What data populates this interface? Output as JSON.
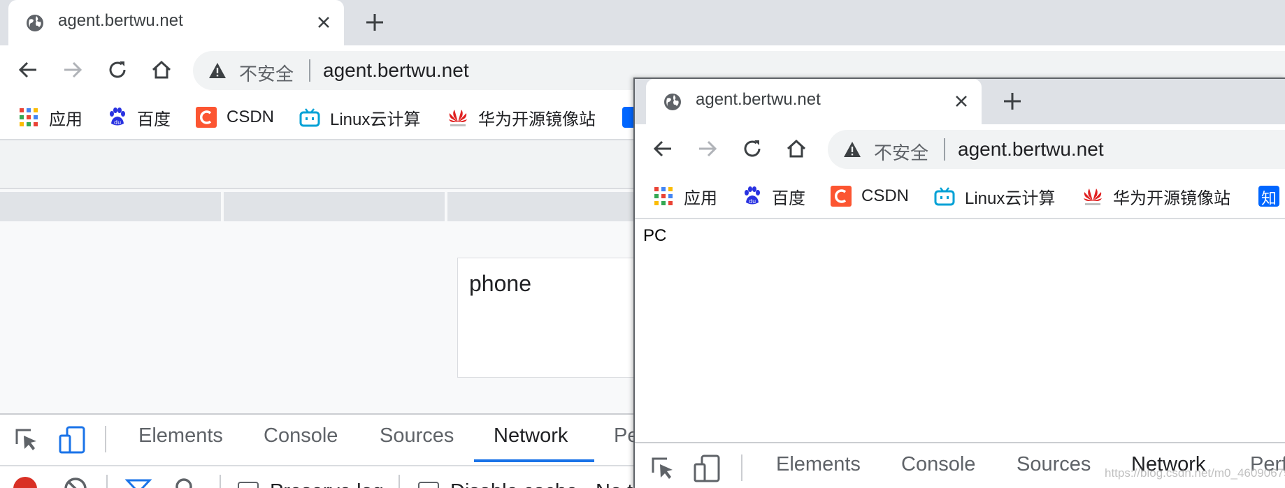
{
  "browser": {
    "tab_title": "agent.bertwu.net",
    "omnibox": {
      "security_label": "不安全",
      "url": "agent.bertwu.net"
    },
    "bookmarks": [
      {
        "label": "应用",
        "icon": "apps-grid-icon"
      },
      {
        "label": "百度",
        "icon": "baidu-paw-icon"
      },
      {
        "label": "CSDN",
        "icon": "csdn-c-icon"
      },
      {
        "label": "Linux云计算",
        "icon": "bilibili-tv-icon"
      },
      {
        "label": "华为开源镜像站",
        "icon": "huawei-logo-icon"
      },
      {
        "label": "知",
        "icon": "zhihu-icon"
      }
    ]
  },
  "back_window": {
    "viewport_text": "phone",
    "devtools": {
      "tabs": [
        "Elements",
        "Console",
        "Sources",
        "Network",
        "Pe"
      ],
      "active_tab": "Network",
      "options": {
        "preserve_log": "Preserve log",
        "disable_cache": "Disable cache",
        "throttle": "No t"
      }
    }
  },
  "front_window": {
    "page_text": "PC",
    "devtools": {
      "tabs": [
        "Elements",
        "Console",
        "Sources",
        "Network",
        "Perf"
      ],
      "active_tab": "Network"
    }
  },
  "watermark": "https://blog.csdn.net/m0_46090675",
  "colors": {
    "tab_strip": "#dee1e6",
    "omnibox_bg": "#f1f3f4",
    "active_tab_underline": "#1a73e8",
    "record_button": "#d93025"
  }
}
